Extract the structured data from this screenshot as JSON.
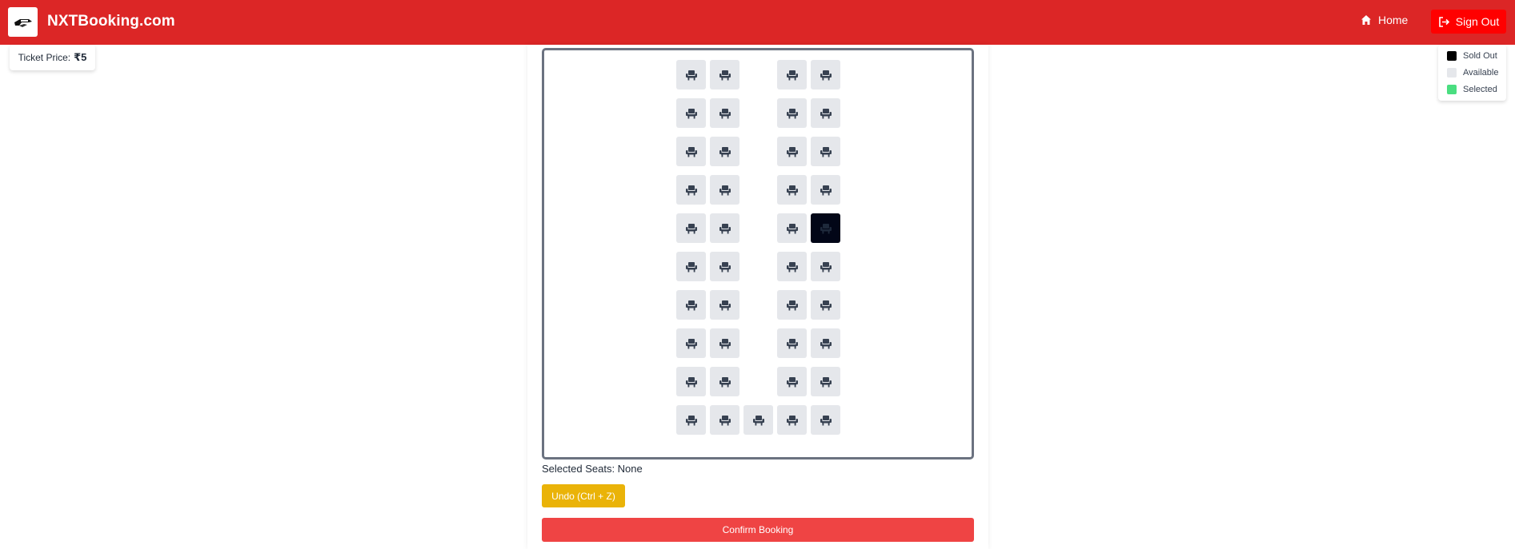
{
  "header": {
    "brand": "NXTBooking.com",
    "logo_icon": "ticket-hand-icon",
    "home_label": "Home",
    "home_icon": "home-icon",
    "signout_label": "Sign Out",
    "signout_icon": "sign-out-icon"
  },
  "price": {
    "label": "Ticket Price:",
    "amount": "₹5"
  },
  "legend": {
    "items": [
      {
        "label": "Sold Out",
        "color": "#000000"
      },
      {
        "label": "Available",
        "color": "#e5e7eb"
      },
      {
        "label": "Selected",
        "color": "#4ade80"
      }
    ]
  },
  "seat_map": {
    "seat_icon": "seat-icon",
    "rows": [
      [
        "available",
        "available",
        "",
        "available",
        "available"
      ],
      [
        "available",
        "available",
        "",
        "available",
        "available"
      ],
      [
        "available",
        "available",
        "",
        "available",
        "available"
      ],
      [
        "available",
        "available",
        "",
        "available",
        "available"
      ],
      [
        "available",
        "available",
        "",
        "available",
        "sold"
      ],
      [
        "available",
        "available",
        "",
        "available",
        "available"
      ],
      [
        "available",
        "available",
        "",
        "available",
        "available"
      ],
      [
        "available",
        "available",
        "",
        "available",
        "available"
      ],
      [
        "available",
        "available",
        "",
        "available",
        "available"
      ],
      [
        "available",
        "available",
        "available",
        "available",
        "available"
      ]
    ]
  },
  "booking": {
    "selected_seats_text": "Selected Seats: None",
    "undo_label": "Undo (Ctrl + Z)",
    "confirm_label": "Confirm Booking"
  },
  "colors": {
    "navbar": "#dc2626",
    "signout": "#ff0000",
    "seat_available": "#e5e7eb",
    "seat_sold": "#020617",
    "seat_icon": "#374151",
    "undo": "#eab308",
    "confirm": "#ef4444"
  }
}
